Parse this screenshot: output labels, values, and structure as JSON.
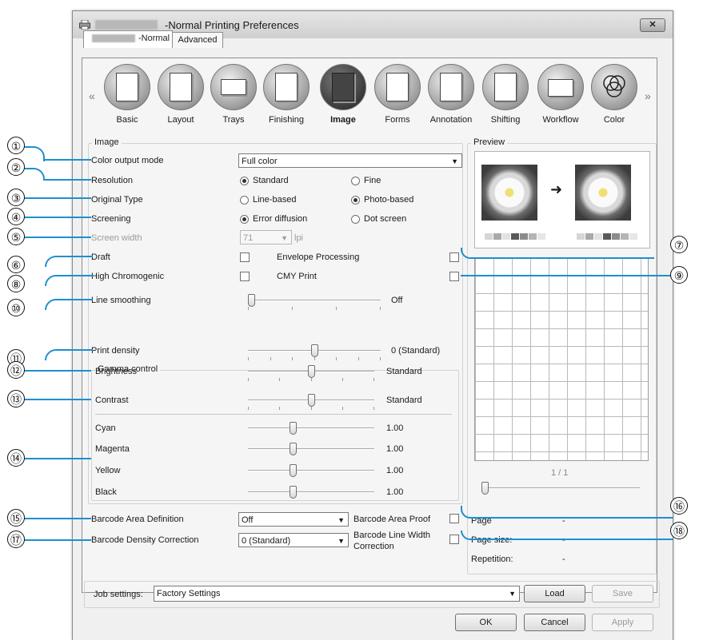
{
  "window": {
    "title": "-Normal Printing Preferences",
    "close_label": "✕"
  },
  "tabs": [
    {
      "label": "-Normal"
    },
    {
      "label": "Advanced"
    }
  ],
  "categories": {
    "prev_arrow": "«",
    "next_arrow": "»",
    "items": [
      {
        "label": "Basic",
        "icon": "basic-icon"
      },
      {
        "label": "Layout",
        "icon": "layout-icon"
      },
      {
        "label": "Trays",
        "icon": "trays-icon"
      },
      {
        "label": "Finishing",
        "icon": "finishing-icon"
      },
      {
        "label": "Image",
        "icon": "image-icon",
        "selected": true
      },
      {
        "label": "Forms",
        "icon": "forms-icon"
      },
      {
        "label": "Annotation",
        "icon": "annotation-icon"
      },
      {
        "label": "Shifting",
        "icon": "shifting-icon"
      },
      {
        "label": "Workflow",
        "icon": "workflow-icon"
      },
      {
        "label": "Color",
        "icon": "color-icon"
      }
    ]
  },
  "image_group": {
    "legend": "Image",
    "color_output_mode": {
      "label": "Color output mode",
      "value": "Full color"
    },
    "resolution": {
      "label": "Resolution",
      "option_a": "Standard",
      "option_b": "Fine",
      "selected": "Standard"
    },
    "original_type": {
      "label": "Original Type",
      "option_a": "Line-based",
      "option_b": "Photo-based",
      "selected": "Photo-based"
    },
    "screening": {
      "label": "Screening",
      "option_a": "Error diffusion",
      "option_b": "Dot screen",
      "selected": "Error diffusion"
    },
    "screen_width": {
      "label": "Screen width",
      "value": "71",
      "unit": "lpi"
    },
    "draft": {
      "label": "Draft",
      "checked": false
    },
    "envelope_processing": {
      "label": "Envelope Processing",
      "checked": false
    },
    "high_chromogenic": {
      "label": "High Chromogenic",
      "checked": false
    },
    "cmy_print": {
      "label": "CMY Print",
      "checked": false
    },
    "line_smoothing": {
      "label": "Line smoothing",
      "value": "Off",
      "level": 0.0
    },
    "print_density": {
      "label": "Print density",
      "value": "0 (Standard)",
      "level": 0.5
    }
  },
  "gamma": {
    "legend": "Gamma control",
    "brightness": {
      "label": "Brightness",
      "value": "Standard",
      "level": 0.5
    },
    "contrast": {
      "label": "Contrast",
      "value": "Standard",
      "level": 0.5
    },
    "cyan": {
      "label": "Cyan",
      "value": "1.00",
      "level": 0.35
    },
    "magenta": {
      "label": "Magenta",
      "value": "1.00",
      "level": 0.35
    },
    "yellow": {
      "label": "Yellow",
      "value": "1.00",
      "level": 0.35
    },
    "black": {
      "label": "Black",
      "value": "1.00",
      "level": 0.35
    }
  },
  "barcode": {
    "area_definition": {
      "label": "Barcode Area Definition",
      "value": "Off"
    },
    "area_proof": {
      "label": "Barcode Area Proof",
      "checked": false
    },
    "density_correction": {
      "label": "Barcode Density Correction",
      "value": "0 (Standard)"
    },
    "line_width_correction": {
      "label_line1": "Barcode Line Width",
      "label_line2": "Correction",
      "checked": false
    }
  },
  "preview": {
    "legend": "Preview",
    "arrow": "➜",
    "page_counter": "1 / 1",
    "page_label": "Page",
    "page_value": "-",
    "page_size_label": "Page size:",
    "page_size_value": "-",
    "repetition_label": "Repetition:",
    "repetition_value": "-",
    "swatch_colors": [
      "#d6d6d6",
      "#a9a9a9",
      "#e2e2e2",
      "#5a5a5a",
      "#8c8c8c",
      "#b5b5b5",
      "#e6e6e6"
    ]
  },
  "footer": {
    "job_settings_label": "Job settings:",
    "job_settings_value": "Factory Settings",
    "load_label": "Load",
    "save_label": "Save",
    "ok_label": "OK",
    "cancel_label": "Cancel",
    "apply_label": "Apply"
  },
  "callouts": [
    "①",
    "②",
    "③",
    "④",
    "⑤",
    "⑥",
    "⑦",
    "⑧",
    "⑨",
    "⑩",
    "⑪",
    "⑫",
    "⑬",
    "⑭",
    "⑮",
    "⑯",
    "⑰",
    "⑱"
  ],
  "accent_color": "#1e8fd0"
}
